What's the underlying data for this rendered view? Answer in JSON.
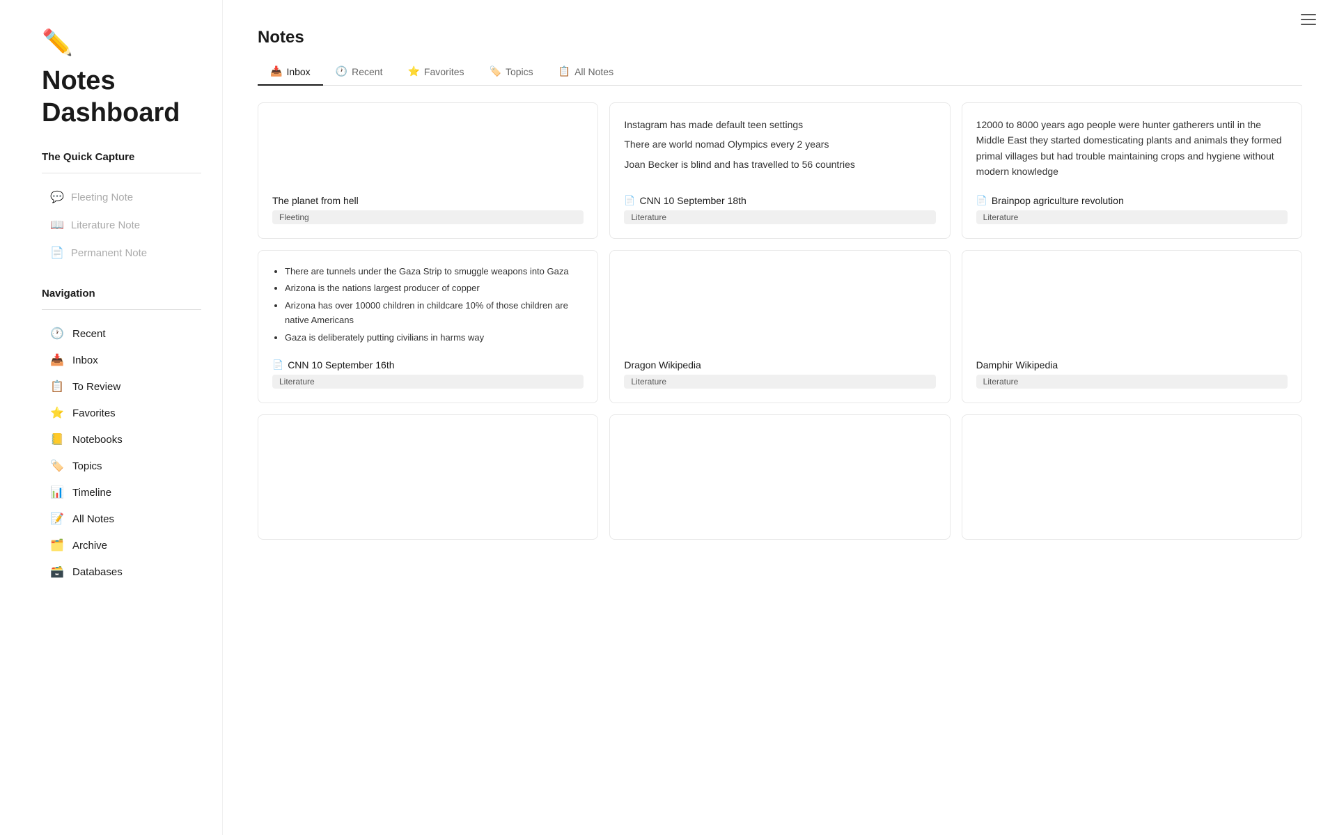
{
  "sidebar": {
    "logo_icon": "✏️",
    "title": "Notes Dashboard",
    "quick_capture": {
      "label": "The Quick Capture",
      "items": [
        {
          "id": "fleeting-note",
          "icon": "💬",
          "label": "Fleeting Note"
        },
        {
          "id": "literature-note",
          "icon": "📖",
          "label": "Literature Note"
        },
        {
          "id": "permanent-note",
          "icon": "📄",
          "label": "Permanent Note"
        }
      ]
    },
    "navigation": {
      "label": "Navigation",
      "items": [
        {
          "id": "recent",
          "icon": "🕐",
          "label": "Recent"
        },
        {
          "id": "inbox",
          "icon": "📥",
          "label": "Inbox"
        },
        {
          "id": "to-review",
          "icon": "📋",
          "label": "To Review"
        },
        {
          "id": "favorites",
          "icon": "⭐",
          "label": "Favorites"
        },
        {
          "id": "notebooks",
          "icon": "📒",
          "label": "Notebooks"
        },
        {
          "id": "topics",
          "icon": "🏷️",
          "label": "Topics"
        },
        {
          "id": "timeline",
          "icon": "📊",
          "label": "Timeline"
        },
        {
          "id": "all-notes",
          "icon": "📝",
          "label": "All Notes"
        },
        {
          "id": "archive",
          "icon": "🗂️",
          "label": "Archive"
        },
        {
          "id": "databases",
          "icon": "🗃️",
          "label": "Databases"
        }
      ]
    }
  },
  "main": {
    "notes_title": "Notes",
    "tabs": [
      {
        "id": "inbox",
        "icon": "📥",
        "label": "Inbox",
        "active": true
      },
      {
        "id": "recent",
        "icon": "🕐",
        "label": "Recent",
        "active": false
      },
      {
        "id": "favorites",
        "icon": "⭐",
        "label": "Favorites",
        "active": false
      },
      {
        "id": "topics",
        "icon": "🏷️",
        "label": "Topics",
        "active": false
      },
      {
        "id": "all-notes",
        "icon": "📋",
        "label": "All Notes",
        "active": false
      }
    ],
    "notes": [
      {
        "id": "card-1",
        "body_type": "text",
        "body_lines": [],
        "title": "The planet from hell",
        "title_icon": "",
        "tag": "Fleeting",
        "has_body": false
      },
      {
        "id": "card-2",
        "body_type": "text",
        "body_lines": [
          "Instagram has made default teen settings",
          "There are world nomad Olympics every 2 years",
          "Joan Becker is blind and has travelled to 56 countries"
        ],
        "title": "CNN 10 September 18th",
        "title_icon": "📄",
        "tag": "Literature",
        "has_body": true
      },
      {
        "id": "card-3",
        "body_type": "text",
        "body_lines": [
          "12000 to 8000 years ago people were hunter gatherers until in the Middle East they started domesticating plants and animals they formed primal villages but had trouble maintaining crops and hygiene without modern knowledge"
        ],
        "title": "Brainpop agriculture revolution",
        "title_icon": "📄",
        "tag": "Literature",
        "has_body": true
      },
      {
        "id": "card-4",
        "body_type": "list",
        "body_lines": [
          "There are tunnels under the Gaza Strip to smuggle weapons into Gaza",
          "Arizona is the nations largest producer of copper",
          "Arizona has over 10000 children in childcare 10% of those children are native Americans",
          "Gaza is deliberately putting civilians in harms way"
        ],
        "title": "CNN 10 September 16th",
        "title_icon": "📄",
        "tag": "Literature",
        "has_body": true
      },
      {
        "id": "card-5",
        "body_type": "text",
        "body_lines": [],
        "title": "Dragon Wikipedia",
        "title_icon": "",
        "tag": "Literature",
        "has_body": false
      },
      {
        "id": "card-6",
        "body_type": "text",
        "body_lines": [],
        "title": "Damphir Wikipedia",
        "title_icon": "",
        "tag": "Literature",
        "has_body": false
      },
      {
        "id": "card-7",
        "body_type": "text",
        "body_lines": [],
        "title": "",
        "title_icon": "",
        "tag": "",
        "has_body": false
      },
      {
        "id": "card-8",
        "body_type": "text",
        "body_lines": [],
        "title": "",
        "title_icon": "",
        "tag": "",
        "has_body": false
      },
      {
        "id": "card-9",
        "body_type": "text",
        "body_lines": [],
        "title": "",
        "title_icon": "",
        "tag": "",
        "has_body": false
      }
    ]
  },
  "hamburger": {
    "lines": 3
  }
}
